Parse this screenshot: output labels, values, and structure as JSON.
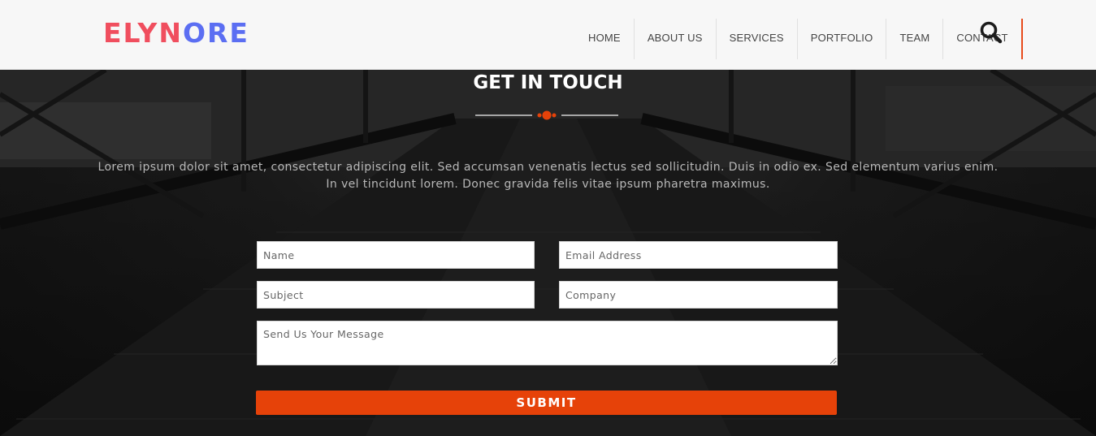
{
  "brand": {
    "part1": "ELYN",
    "part2": "ORE",
    "color1": "#f04e5e",
    "color2": "#5b6ef2"
  },
  "nav": {
    "items": [
      {
        "label": "HOME"
      },
      {
        "label": "ABOUT US"
      },
      {
        "label": "SERVICES"
      },
      {
        "label": "PORTFOLIO"
      },
      {
        "label": "TEAM"
      },
      {
        "label": "CONTACT"
      }
    ],
    "search_icon": "search-icon"
  },
  "section": {
    "title": "GET IN TOUCH",
    "description": "Lorem ipsum dolor sit amet, consectetur adipiscing elit. Sed accumsan venenatis lectus sed sollicitudin. Duis in odio ex. Sed elementum varius enim. In vel tincidunt lorem. Donec gravida felis vitae ipsum pharetra maximus."
  },
  "form": {
    "name_placeholder": "Name",
    "email_placeholder": "Email Address",
    "subject_placeholder": "Subject",
    "company_placeholder": "Company",
    "message_placeholder": "Send Us Your Message",
    "submit_label": "SUBMIT"
  },
  "colors": {
    "accent": "#e64209",
    "header_bg": "#f7f7f7"
  }
}
